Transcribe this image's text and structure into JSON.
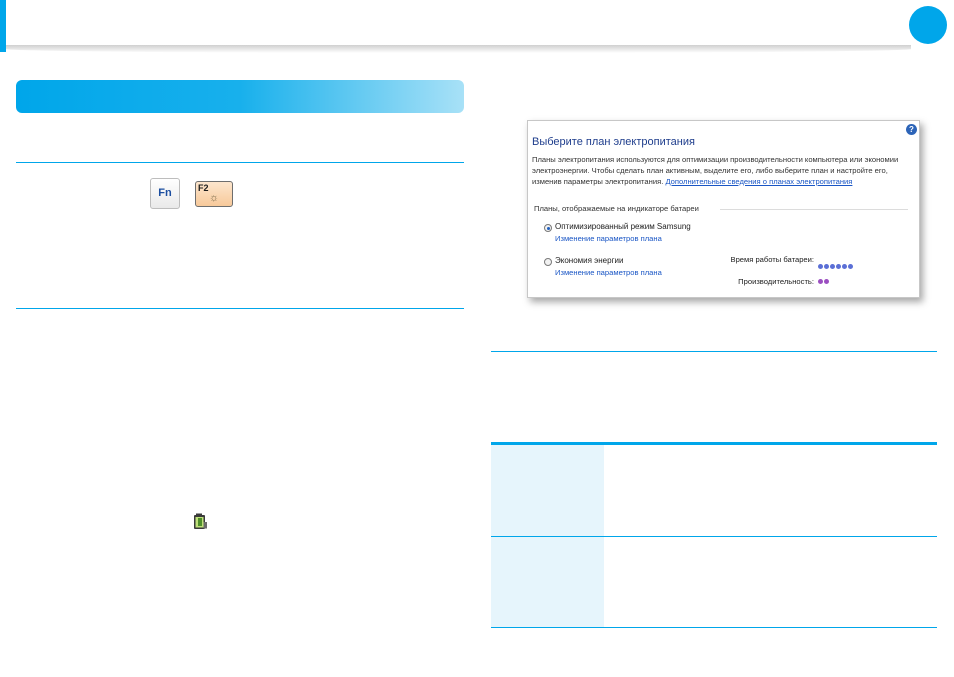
{
  "colors": {
    "accent": "#00a6ea",
    "section_bar_end": "#a8e1f7",
    "table_fill": "#e6f5fc",
    "key_f2": "#f7c99a"
  },
  "icons": {
    "fn_key": "fn-key-icon",
    "f2_key": "f2-brightness-key-icon",
    "battery": "battery-icon",
    "help": "help-icon"
  },
  "keys": {
    "fn": "Fn",
    "f2": "F2"
  },
  "power_window": {
    "help": "?",
    "title": "Выберите план электропитания",
    "description": "Планы электропитания используются для оптимизации производительности компьютера или экономии электроэнергии. Чтобы сделать план активным, выделите его, либо выберите план и настройте его, изменив параметры электропитания.",
    "more_link": "Дополнительные сведения о планах электропитания",
    "group_label": "Планы, отображаемые на индикаторе батареи",
    "plans": [
      {
        "name": "Оптимизированный режим Samsung",
        "change": "Изменение параметров плана",
        "selected": true
      },
      {
        "name": "Экономия энергии",
        "change": "Изменение параметров плана",
        "selected": false
      }
    ],
    "stats": {
      "battery_label": "Время работы батареи:",
      "battery_level": 6,
      "performance_label": "Производительность:",
      "performance_level": 2
    }
  }
}
